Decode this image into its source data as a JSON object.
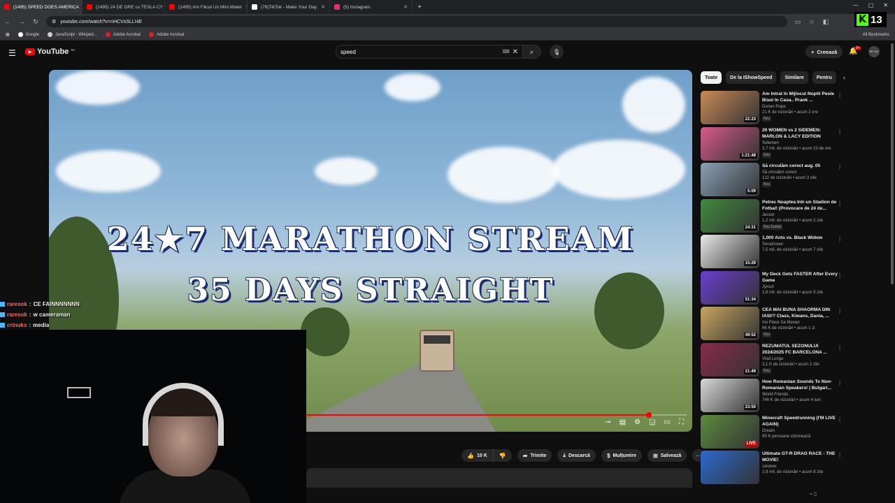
{
  "browser": {
    "tabs": [
      {
        "title": "(1495) SPEED DOES AMERICA",
        "color": "#ff0000",
        "active": true
      },
      {
        "title": "(1495) 24 DE ORE cu TESLA CY",
        "color": "#ff0000",
        "active": false
      },
      {
        "title": "(1495) Am Făcut Un Mini-Water",
        "color": "#ff0000",
        "active": false
      },
      {
        "title": "(78)TikTok - Make Your Day",
        "color": "#ffffff",
        "active": false
      },
      {
        "title": "(5) Instagram",
        "color": "#e1306c",
        "active": false
      }
    ],
    "url": "youtube.com/watch?v=nHCVsSLLI4E",
    "bookmarks": [
      "Google",
      "JavaScript - Wikiped...",
      "Adobe Acrobat",
      "Adobe Acrobat"
    ],
    "all_bookmarks": "All Bookmarks"
  },
  "kick": {
    "count": "13"
  },
  "youtube": {
    "logo_text": "YouTube",
    "region": "RO",
    "search_value": "speed",
    "create_label": "Creează",
    "notif_count": "9+",
    "avatar_text": "SE KAI"
  },
  "video": {
    "title_line1": "24★7 MARATHON STREAM",
    "title_line2": "35 DAYS STRAIGHT",
    "progress_fraction": 0.9
  },
  "actions": {
    "likes": "10 K",
    "share": "Trimite",
    "download": "Descarcă",
    "thanks": "Mulțumire",
    "save": "Salvează"
  },
  "chips": [
    "Toate",
    "De la IShowSpeed",
    "Similare",
    "Pentru"
  ],
  "recommendations": [
    {
      "title": "Am Intrat In Mijlocul Noptii Peste Bisoi In Casa.. Prank ...",
      "channel": "Dorian Popa",
      "meta": "21 K de vizionări • acum 2 ore",
      "badge": "Nou",
      "duration": "22:23",
      "live": false,
      "color": "#c98a55"
    },
    {
      "title": "20 WOMEN vs 2 SIDEMEN: MARLON & LACY EDITION",
      "channel": "Sidemen",
      "meta": "3,7 mil. de vizionări • acum 23 de ore",
      "badge": "Nou",
      "duration": "1:21:48",
      "live": false,
      "color": "#d65a8a"
    },
    {
      "title": "Să circulăm corect aug. 05",
      "channel": "Să circulăm corect",
      "meta": "122 de vizionări • acum 3 zile",
      "badge": "Nou",
      "duration": "5:09",
      "live": false,
      "color": "#8aa0b5"
    },
    {
      "title": "Petrec Noaptea într-un Stadion de Fotbal! (Provocare de 24 de...",
      "channel": "Jesser",
      "meta": "1,2 mil. de vizionări • acum 2 zile",
      "badge": "Nou  Dublat",
      "duration": "24:31",
      "live": false,
      "color": "#3f8a3f"
    },
    {
      "title": "1,000 Ants vs. Black Widow",
      "channel": "TerraGreen",
      "meta": "7,5 mil. de vizionări • acum 7 zile",
      "badge": "",
      "duration": "15:29",
      "live": false,
      "color": "#e8e8e8"
    },
    {
      "title": "My Deck Gets FASTER After Every Game",
      "channel": "Jynxzi",
      "meta": "1,6 mil. de vizionări • acum 5 zile",
      "badge": "",
      "duration": "51:34",
      "live": false,
      "color": "#6a3fd1"
    },
    {
      "title": "CEA MAI BUNA SHAORMA DIN IASI!? Class, Kiwans, Dania, ...",
      "channel": "Imi Place Sa Manan",
      "meta": "66 K de vizionări • acum 1 zi",
      "badge": "Nou",
      "duration": "49:52",
      "live": false,
      "color": "#c7a560"
    },
    {
      "title": "REZUMATUL SEZONULUI 2024/2025 FC BARCELONA ...",
      "channel": "Vlad Lungu",
      "meta": "3,1 K de vizionări • acum 2 zile",
      "badge": "Nou",
      "duration": "21:49",
      "live": false,
      "color": "#8a2a4a"
    },
    {
      "title": "How Romanian Sounds To Non-Romanian Speakers! | Bulgari...",
      "channel": "World Friends",
      "meta": "746 K de vizionări • acum 4 luni",
      "badge": "",
      "duration": "23:50",
      "live": false,
      "color": "#d8d8d8"
    },
    {
      "title": "Minecraft Speedrunning (I'M LIVE AGAIN)",
      "channel": "Dream",
      "meta": "85 K persoane vizionează",
      "badge": "",
      "duration": "LIVE",
      "live": true,
      "color": "#5d8a3f"
    },
    {
      "title": "Ultimate GT-R DRAG RACE - THE MOVIE!",
      "channel": "carwow",
      "meta": "2,9 mil. de vizionări • acum 8 zile",
      "badge": "",
      "duration": "",
      "live": false,
      "color": "#2a6ad1"
    }
  ],
  "chat": [
    {
      "user": "raresok",
      "message": "CE FAINNNNNNN"
    },
    {
      "user": "raresok",
      "message": "w cameraman"
    },
    {
      "user": "crinuks",
      "message": "media"
    }
  ]
}
